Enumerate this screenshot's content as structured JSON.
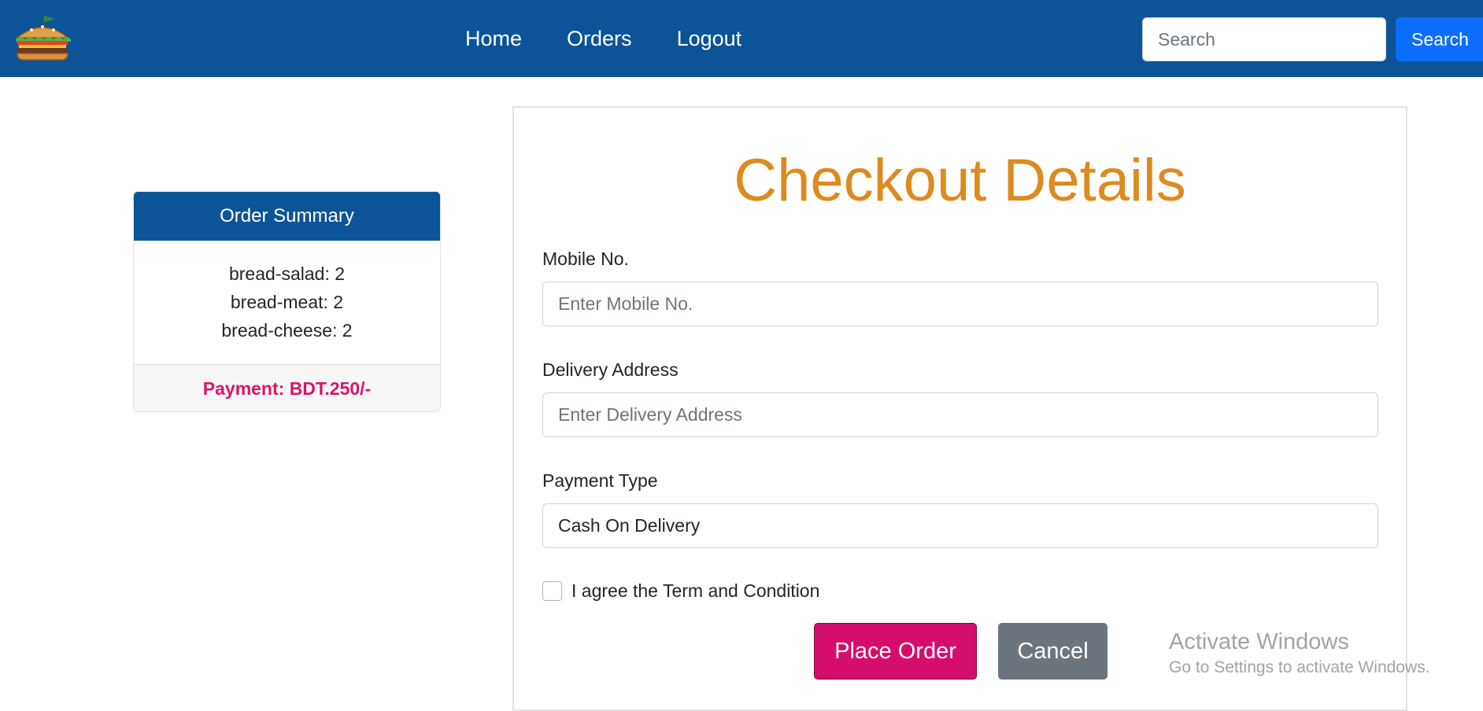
{
  "nav": {
    "links": [
      {
        "label": "Home"
      },
      {
        "label": "Orders"
      },
      {
        "label": "Logout"
      }
    ],
    "search": {
      "placeholder": "Search",
      "button_label": "Search"
    }
  },
  "summary": {
    "header": "Order Summary",
    "items": [
      "bread-salad: 2",
      "bread-meat: 2",
      "bread-cheese: 2"
    ],
    "payment": "Payment: BDT.250/-"
  },
  "checkout": {
    "title": "Checkout Details",
    "mobile": {
      "label": "Mobile No.",
      "placeholder": "Enter Mobile No."
    },
    "address": {
      "label": "Delivery Address",
      "placeholder": "Enter Delivery Address"
    },
    "payment_type": {
      "label": "Payment Type",
      "value": "Cash On Delivery"
    },
    "terms_label": "I agree the Term and Condition",
    "place_order_label": "Place Order",
    "cancel_label": "Cancel"
  },
  "watermark": {
    "title": "Activate Windows",
    "subtitle": "Go to Settings to activate Windows."
  },
  "colors": {
    "navbar": "#0c5497",
    "title": "#dd8a1f",
    "payment": "#d6166b",
    "place_order": "#d50e6c",
    "cancel": "#6c757d",
    "search_button": "#0d6efd"
  }
}
